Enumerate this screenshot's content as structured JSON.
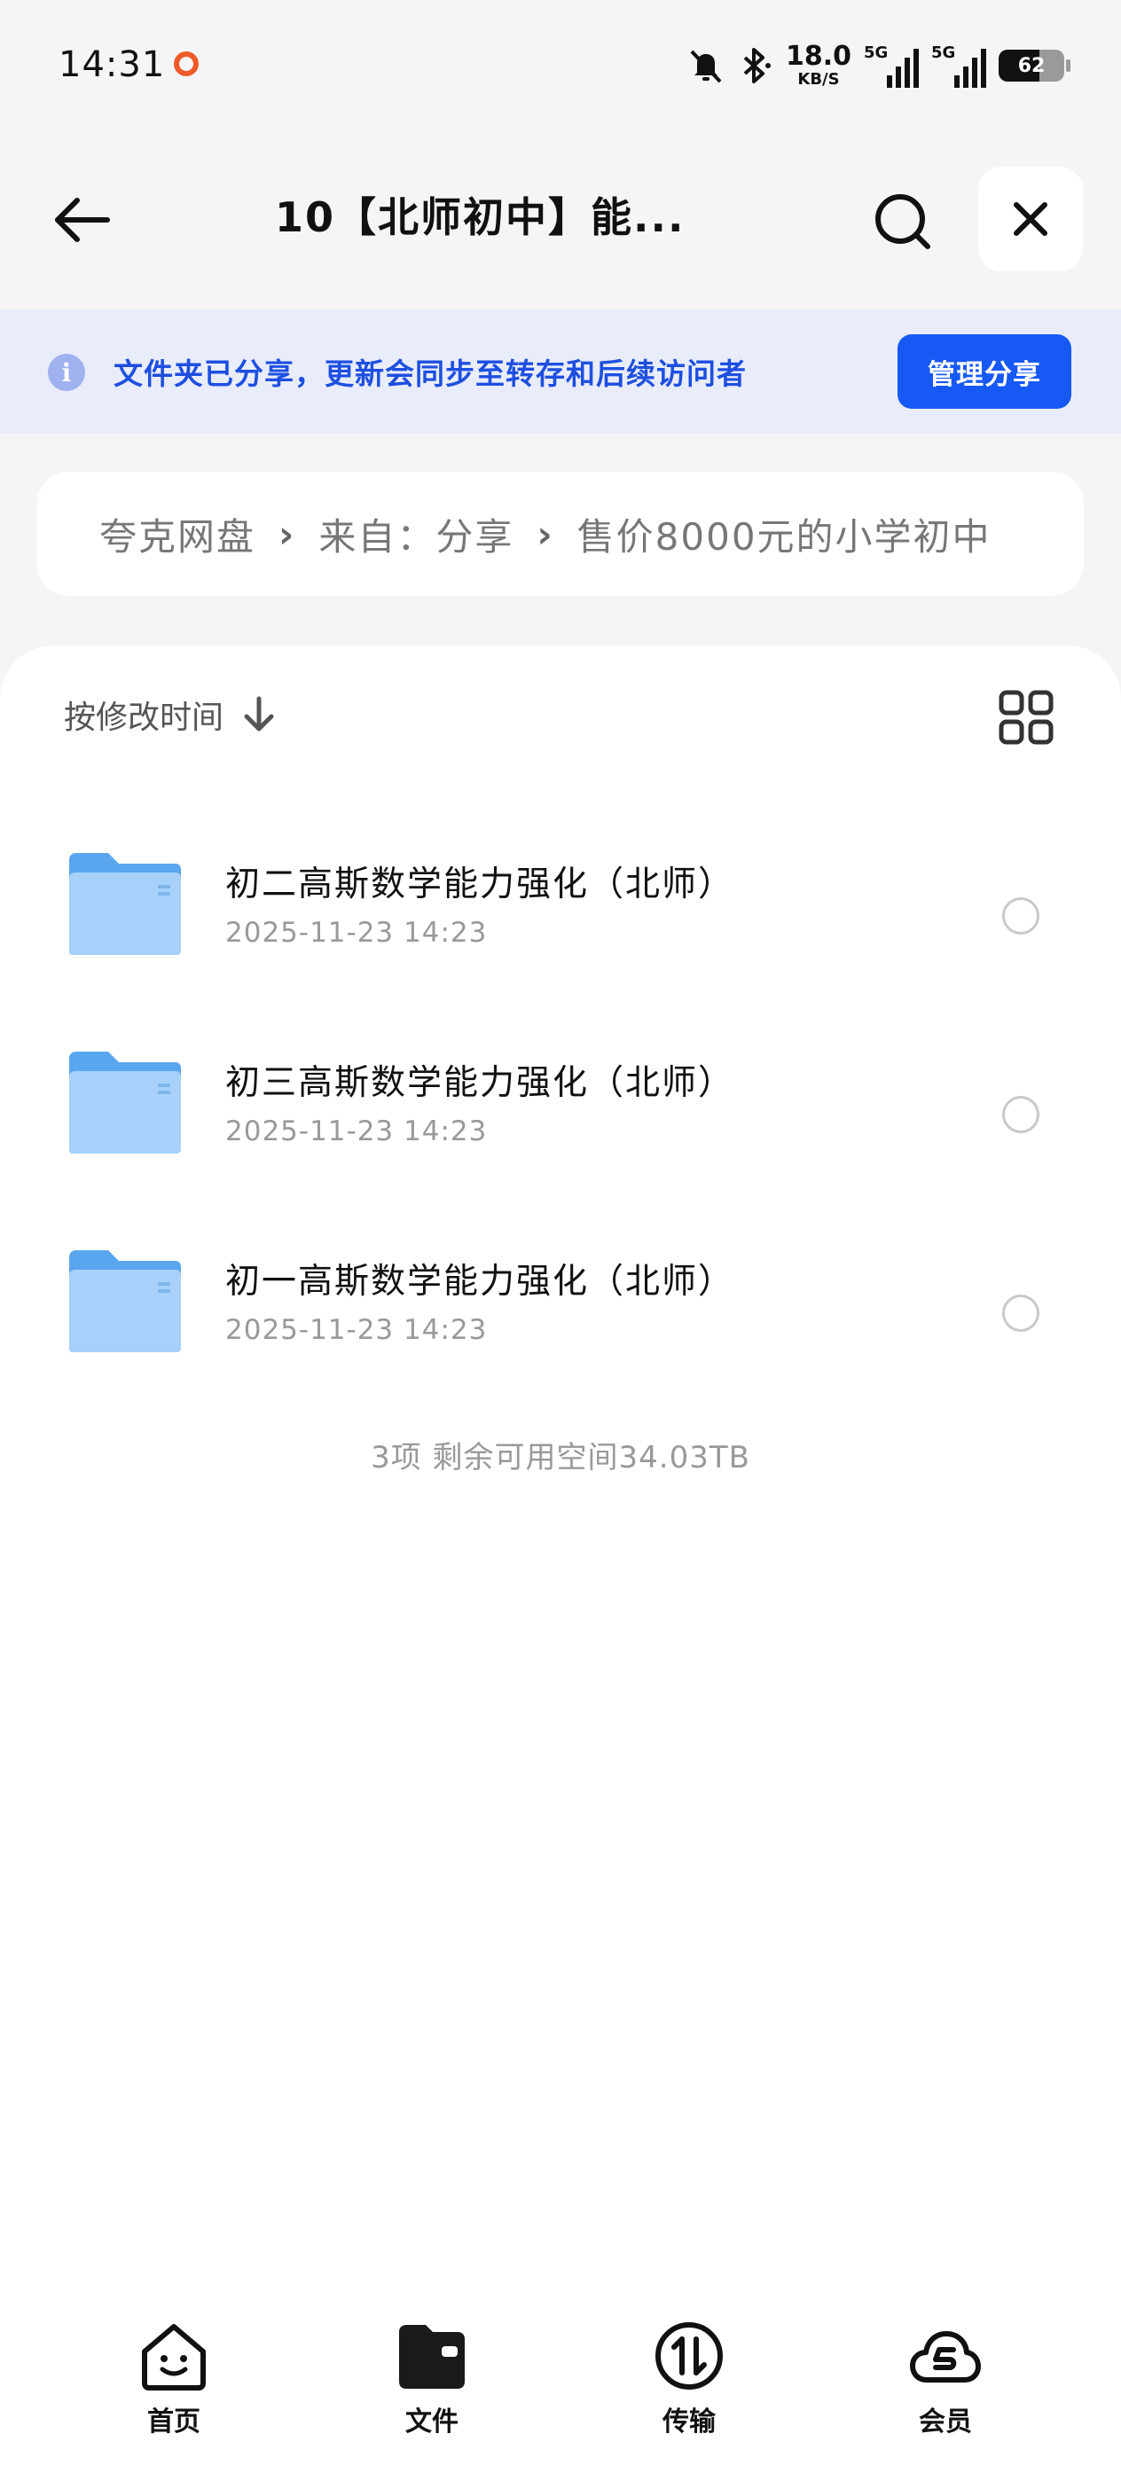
{
  "status_bar": {
    "time": "14:31",
    "net_speed_value": "18.0",
    "net_speed_unit": "KB/S",
    "sim1_type": "5G",
    "sim2_type": "5G",
    "battery": "62"
  },
  "header": {
    "title": "10【北师初中】能..."
  },
  "banner": {
    "message": "文件夹已分享，更新会同步至转存和后续访问者",
    "manage_button": "管理分享"
  },
  "breadcrumb": {
    "items": [
      "夸克网盘",
      "来自：分享",
      "售价8000元的小学初中"
    ],
    "separator": "›"
  },
  "list": {
    "sort_label": "按修改时间",
    "files": [
      {
        "name": "初二高斯数学能力强化（北师）",
        "time": "2025-11-23 14:23"
      },
      {
        "name": "初三高斯数学能力强化（北师）",
        "time": "2025-11-23 14:23"
      },
      {
        "name": "初一高斯数学能力强化（北师）",
        "time": "2025-11-23 14:23"
      }
    ],
    "summary": "3项 剩余可用空间34.03TB"
  },
  "bottom_nav": {
    "items": [
      {
        "label": "首页",
        "icon": "home-face-icon"
      },
      {
        "label": "文件",
        "icon": "files-folder-icon"
      },
      {
        "label": "传输",
        "icon": "transfer-icon"
      },
      {
        "label": "会员",
        "icon": "vip-cloud-icon"
      }
    ]
  },
  "colors": {
    "accent": "#1659f5",
    "banner_bg": "#e9ecfb",
    "banner_text": "#1d4fe0",
    "folder": "#8ec5f7"
  }
}
